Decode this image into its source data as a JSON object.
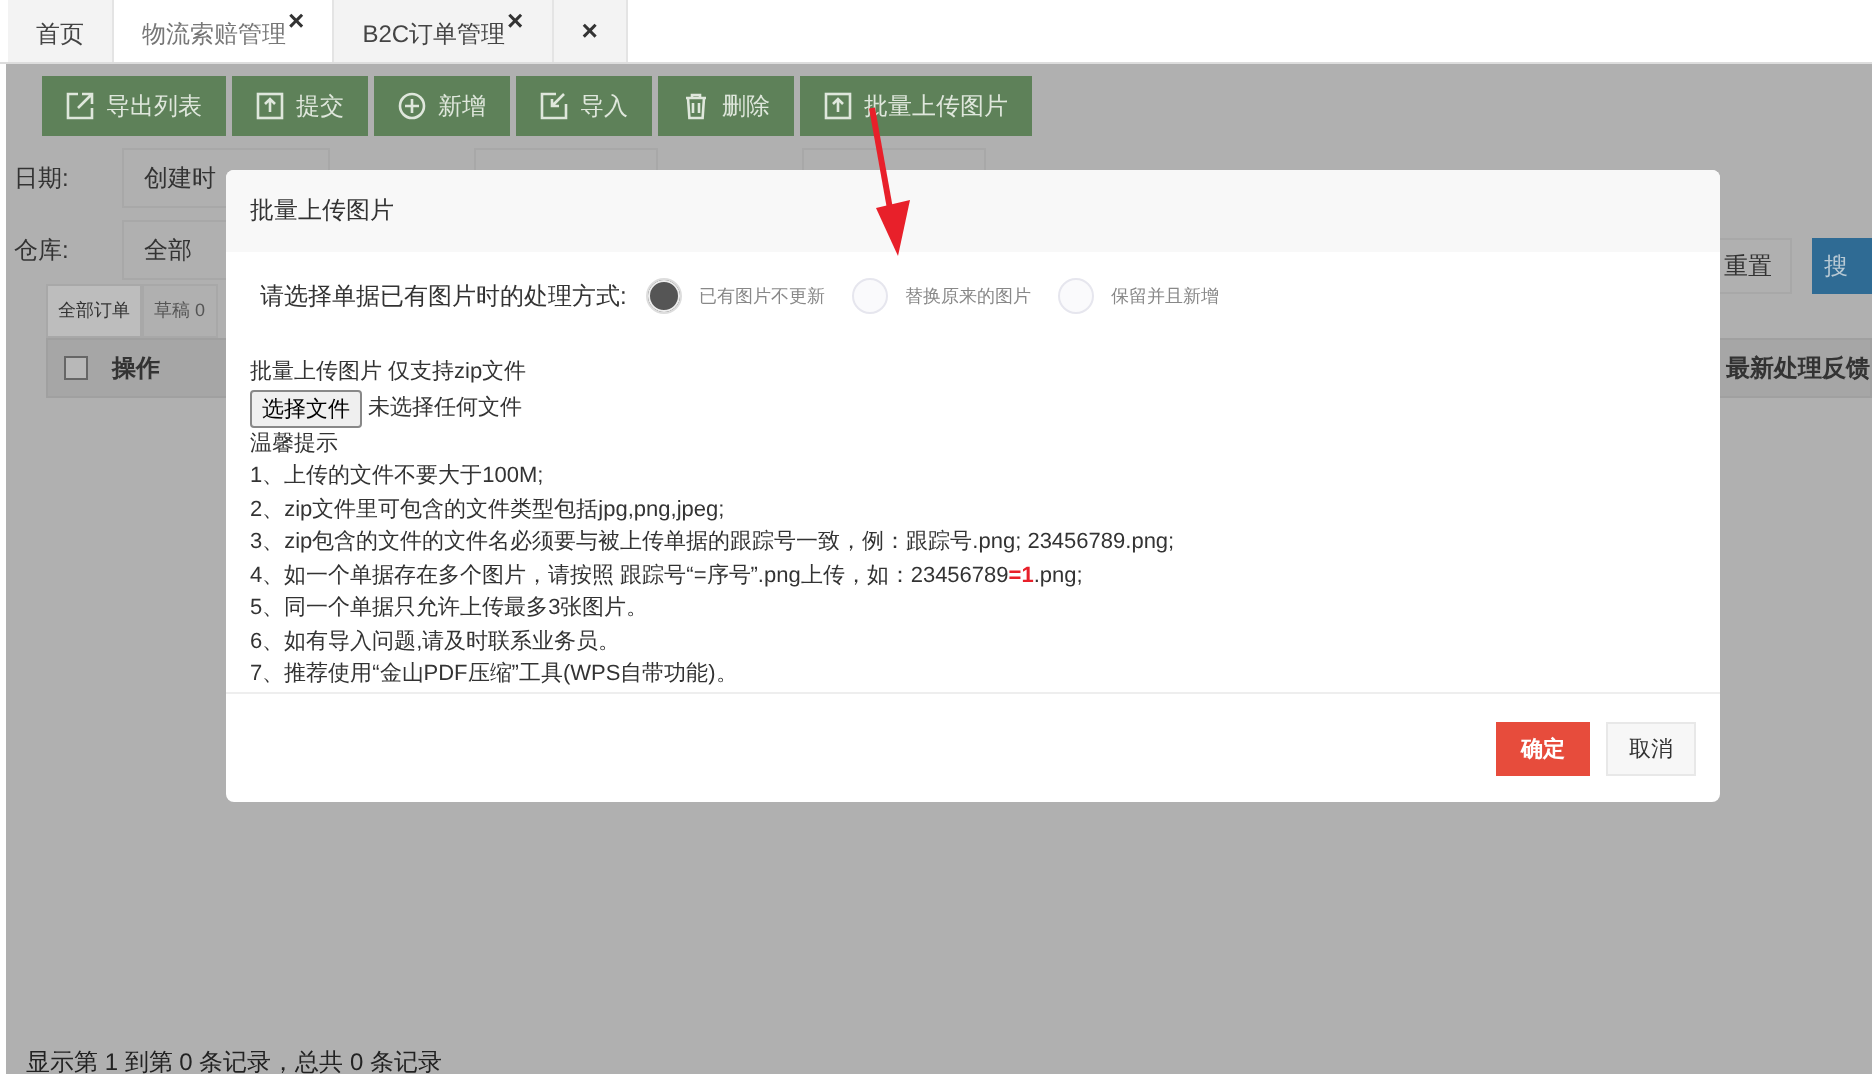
{
  "tabs": [
    {
      "label": "首页",
      "closable": false,
      "selected": false
    },
    {
      "label": "物流索赔管理",
      "closable": true,
      "selected": true
    },
    {
      "label": "B2C订单管理",
      "closable": true,
      "selected": false
    },
    {
      "closable": true,
      "selected": false
    }
  ],
  "close_glyph": "×",
  "toolbar": [
    {
      "label": "导出列表",
      "kind": "export"
    },
    {
      "label": "提交",
      "kind": "upload"
    },
    {
      "label": "新增",
      "kind": "plus"
    },
    {
      "label": "导入",
      "kind": "import"
    },
    {
      "label": "删除",
      "kind": "trash"
    },
    {
      "label": "批量上传图片",
      "kind": "upload"
    }
  ],
  "filters": {
    "date_label": "日期:",
    "date_value": "创建时",
    "warehouse_label": "仓库:",
    "warehouse_value": "全部",
    "reset_button": "重置",
    "search_button": "搜"
  },
  "order_tabs": [
    {
      "label": "全部订单",
      "selected": true
    },
    {
      "label": "草稿 0",
      "selected": false
    }
  ],
  "table": {
    "columns": [
      "操作",
      "最新处理反馈"
    ],
    "select_all_checked": false
  },
  "footer": "显示第 1 到第 0 条记录，总共 0 条记录",
  "modal": {
    "title": "批量上传图片",
    "radio_prompt": "请选择单据已有图片时的处理方式:",
    "options": [
      {
        "label": "已有图片不更新",
        "selected": true
      },
      {
        "label": "替换原来的图片",
        "selected": false
      },
      {
        "label": "保留并且新增",
        "selected": false
      }
    ],
    "upload_label": "批量上传图片 仅支持zip文件",
    "file_button": "选择文件",
    "file_status": "未选择任何文件",
    "tips_title": "温馨提示",
    "tips": [
      [
        {
          "text": "1、上传的文件不要大于100M;",
          "highlight": false
        }
      ],
      [
        {
          "text": "2、zip文件里可包含的文件类型包括jpg,png,jpeg;",
          "highlight": false
        }
      ],
      [
        {
          "text": "3、zip包含的文件的文件名必须要与被上传单据的跟踪号一致，例：跟踪号.png; 23456789.png;",
          "highlight": false
        }
      ],
      [
        {
          "text": "4、如一个单据存在多个图片，请按照 跟踪号“=序号”.png上传，如：23456789",
          "highlight": false
        },
        {
          "text": "=1",
          "highlight": true
        },
        {
          "text": ".png;",
          "highlight": false
        }
      ],
      [
        {
          "text": "5、同一个单据只允许上传最多3张图片。",
          "highlight": false
        }
      ],
      [
        {
          "text": "6、如有导入问题,请及时联系业务员。",
          "highlight": false
        }
      ],
      [
        {
          "text": "7、推荐使用“金山PDF压缩”工具(WPS自带功能)。",
          "highlight": false
        }
      ]
    ],
    "confirm_button": "确定",
    "cancel_button": "取消"
  }
}
